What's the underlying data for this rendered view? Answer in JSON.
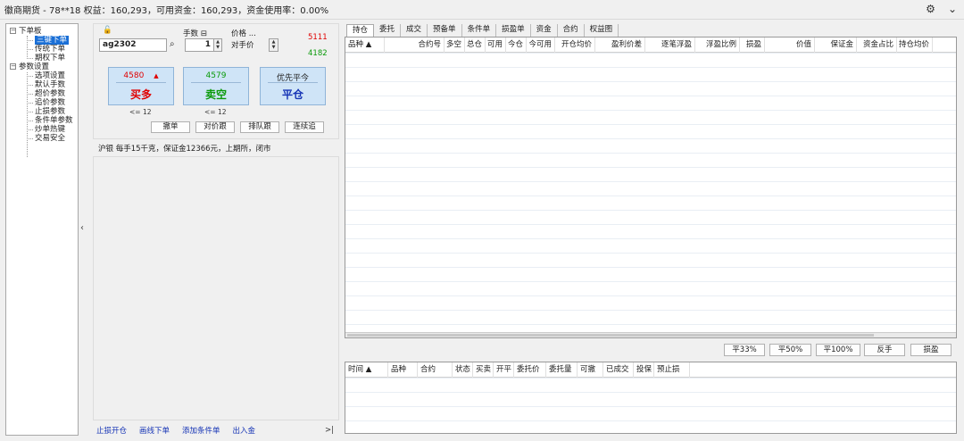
{
  "title": "徽商期货 - 78**18  权益：160,293，可用资金：160,293，资金使用率：0.00%",
  "tree": [
    {
      "label": "下单板",
      "level": 0,
      "box": "−"
    },
    {
      "label": "三键下单",
      "level": 1,
      "selected": true
    },
    {
      "label": "传统下单",
      "level": 1
    },
    {
      "label": "期权下单",
      "level": 1
    },
    {
      "label": "参数设置",
      "level": 0,
      "box": "−"
    },
    {
      "label": "选项设置",
      "level": 1
    },
    {
      "label": "默认手数",
      "level": 1
    },
    {
      "label": "超价参数",
      "level": 1
    },
    {
      "label": "追价参数",
      "level": 1
    },
    {
      "label": "止损参数",
      "level": 1
    },
    {
      "label": "条件单参数",
      "level": 1
    },
    {
      "label": "炒单热键",
      "level": 1
    },
    {
      "label": "交易安全",
      "level": 1
    }
  ],
  "order": {
    "lock_icon": "🔓",
    "symbol": "ag2302",
    "lots_label": "手数 ⊟",
    "lots": "1",
    "price_label": "价格 ...",
    "price_type": "对手价",
    "ask": "5111",
    "bid": "4182",
    "buy_price": "4580",
    "buy_label": "买多",
    "sell_price": "4579",
    "sell_label": "卖空",
    "close_top": "优先平今",
    "close_label": "平仓",
    "buy_limit": "<= 12",
    "sell_limit": "<= 12",
    "btn_cancel": "撤单",
    "btn_follow": "对价跟",
    "btn_queue": "排队跟",
    "btn_chase": "连续追"
  },
  "info": "沪银  每手15千克，保证金12366元，上期所，闭市",
  "bottom_links": [
    "止损开仓",
    "画线下单",
    "添加条件单",
    "出入金"
  ],
  "tabs": [
    "持仓",
    "委托",
    "成交",
    "预备单",
    "条件单",
    "损盈单",
    "资金",
    "合约",
    "权益图"
  ],
  "position_columns": [
    "品种 ▲",
    "合约号",
    "多空",
    "总仓",
    "可用",
    "今仓",
    "今可用",
    "开仓均价",
    "盈利价差",
    "逐笔浮盈",
    "浮盈比例",
    "损盈",
    "价值",
    "保证金",
    "资金占比",
    "持仓均价"
  ],
  "actions": [
    "平33%",
    "平50%",
    "平100%",
    "反手",
    "损盈"
  ],
  "order_columns": [
    "时间 ▲",
    "品种",
    "合约",
    "状态",
    "买卖",
    "开平",
    "委托价",
    "委托量",
    "可撤",
    "已成交",
    "投保",
    "预止损"
  ]
}
